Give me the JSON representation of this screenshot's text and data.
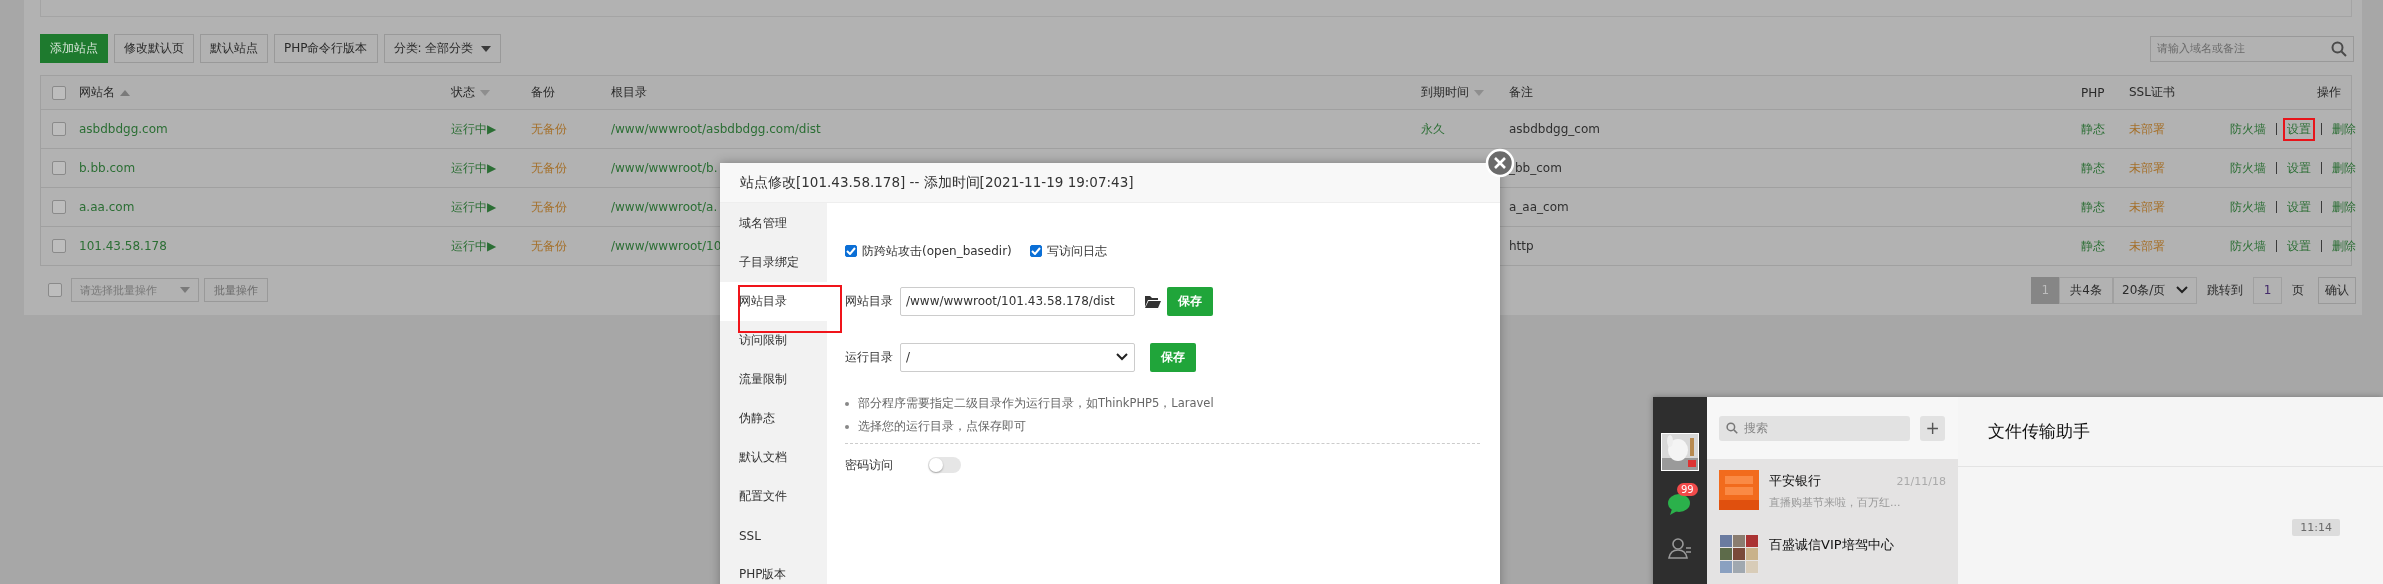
{
  "toolbar": {
    "buttons": [
      {
        "label": "添加站点",
        "kind": "primary"
      },
      {
        "label": "修改默认页",
        "kind": "plain"
      },
      {
        "label": "默认站点",
        "kind": "plain"
      },
      {
        "label": "PHP命令行版本",
        "kind": "plain"
      }
    ],
    "category_filter": "分类: 全部分类",
    "search": {
      "placeholder": "请输入域名或备注"
    }
  },
  "table": {
    "all_checked": false,
    "columns": [
      {
        "label": "网站名",
        "kind": "sorted"
      },
      {
        "label": "状态",
        "kind": "sortable"
      },
      {
        "label": "备份",
        "kind": "plain"
      },
      {
        "label": "根目录",
        "kind": "plain"
      },
      {
        "label": "到期时间",
        "kind": "sortable"
      },
      {
        "label": "备注",
        "kind": "plain"
      },
      {
        "label": "PHP",
        "kind": "plain"
      },
      {
        "label": "SSL证书",
        "kind": "plain"
      },
      {
        "label": "操作",
        "kind": "plain"
      }
    ],
    "rows": [
      {
        "checked": false,
        "name": "asbdbdgg.com",
        "status": "运行中▶",
        "backup": "无备份",
        "root": "/www/wwwroot/asbdbdgg.com/dist",
        "expiry": "永久",
        "note": "asbdbdgg_com",
        "php": "静态",
        "ssl": "未部署",
        "actions": [
          {
            "label": "防火墙",
            "highlighted": false
          },
          {
            "label": "设置",
            "highlighted": true
          },
          {
            "label": "删除",
            "highlighted": false
          }
        ]
      },
      {
        "checked": false,
        "name": "b.bb.com",
        "status": "运行中▶",
        "backup": "无备份",
        "root": "/www/wwwroot/b.",
        "note": "_bb_com",
        "php": "静态",
        "ssl": "未部署",
        "actions": [
          {
            "label": "防火墙",
            "highlighted": false
          },
          {
            "label": "设置",
            "highlighted": false
          },
          {
            "label": "删除",
            "highlighted": false
          }
        ]
      },
      {
        "checked": false,
        "name": "a.aa.com",
        "status": "运行中▶",
        "backup": "无备份",
        "root": "/www/wwwroot/a.",
        "note": "a_aa_com",
        "php": "静态",
        "ssl": "未部署",
        "actions": [
          {
            "label": "防火墙",
            "highlighted": false
          },
          {
            "label": "设置",
            "highlighted": false
          },
          {
            "label": "删除",
            "highlighted": false
          }
        ]
      },
      {
        "checked": false,
        "name": "101.43.58.178",
        "status": "运行中▶",
        "backup": "无备份",
        "root": "/www/wwwroot/10",
        "note": "http",
        "php": "静态",
        "ssl": "未部署",
        "actions": [
          {
            "label": "防火墙",
            "highlighted": false
          },
          {
            "label": "设置",
            "highlighted": false
          },
          {
            "label": "删除",
            "highlighted": false
          }
        ]
      }
    ]
  },
  "batch": {
    "checked": false,
    "placeholder": "请选择批量操作",
    "button": "批量操作"
  },
  "pagination": {
    "current": "1",
    "total": "共4条",
    "per_page": "20条/页",
    "goto_label": "跳转到",
    "goto_value": "1",
    "page_unit": "页",
    "confirm": "确认"
  },
  "dialog": {
    "title": "站点修改[101.43.58.178] -- 添加时间[2021-11-19 19:07:43]",
    "menu": [
      {
        "label": "域名管理",
        "selected": false,
        "highlighted": false
      },
      {
        "label": "子目录绑定",
        "selected": false,
        "highlighted": false
      },
      {
        "label": "网站目录",
        "selected": true,
        "highlighted": true
      },
      {
        "label": "访问限制",
        "selected": false,
        "highlighted": false
      },
      {
        "label": "流量限制",
        "selected": false,
        "highlighted": false
      },
      {
        "label": "伪静态",
        "selected": false,
        "highlighted": false
      },
      {
        "label": "默认文档",
        "selected": false,
        "highlighted": false
      },
      {
        "label": "配置文件",
        "selected": false,
        "highlighted": false
      },
      {
        "label": "SSL",
        "selected": false,
        "highlighted": false
      },
      {
        "label": "PHP版本",
        "selected": false,
        "highlighted": false
      }
    ],
    "options": [
      {
        "label": "防跨站攻击(open_basedir)",
        "checked": true
      },
      {
        "label": "写访问日志",
        "checked": true
      }
    ],
    "site_dir": {
      "label": "网站目录",
      "value": "/www/wwwroot/101.43.58.178/dist",
      "button": "保存"
    },
    "run_dir": {
      "label": "运行目录",
      "value": "/",
      "button": "保存"
    },
    "notes": [
      "部分程序需要指定二级目录作为运行目录，如ThinkPHP5，Laravel",
      "选择您的运行目录，点保存即可"
    ],
    "password_access": {
      "label": "密码访问",
      "on": false
    }
  },
  "chat_window": {
    "badge": "99",
    "search": {
      "placeholder": "搜索"
    },
    "add_button": "+",
    "title": "文件传输助手",
    "timestamp": "11:14",
    "conversations": [
      {
        "name": "平安银行",
        "time": "21/11/18",
        "preview": "直播购基节来啦，百万红...",
        "kind": "logo"
      },
      {
        "name": "百盛诚信VIP培驾中心",
        "kind": "group"
      }
    ]
  }
}
